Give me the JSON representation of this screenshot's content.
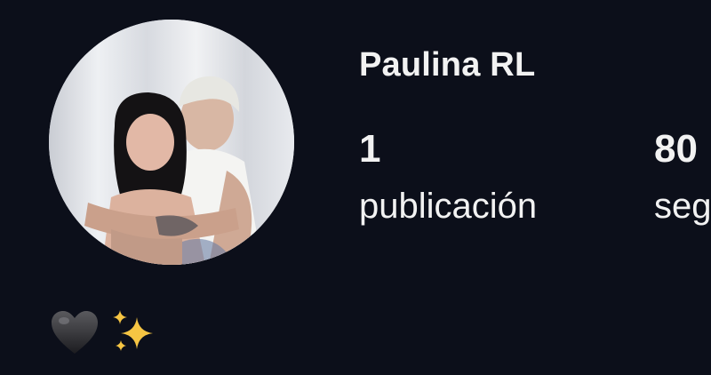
{
  "profile": {
    "display_name": "Paulina RL",
    "stats": [
      {
        "count": "1",
        "label": "publicación"
      },
      {
        "count": "80",
        "label": "seg"
      }
    ],
    "bio_icons": [
      "black-heart-icon",
      "sparkles-icon"
    ]
  },
  "colors": {
    "background": "#0c0f1a",
    "text": "#f2f2f2",
    "sparkle": "#f6c543"
  }
}
